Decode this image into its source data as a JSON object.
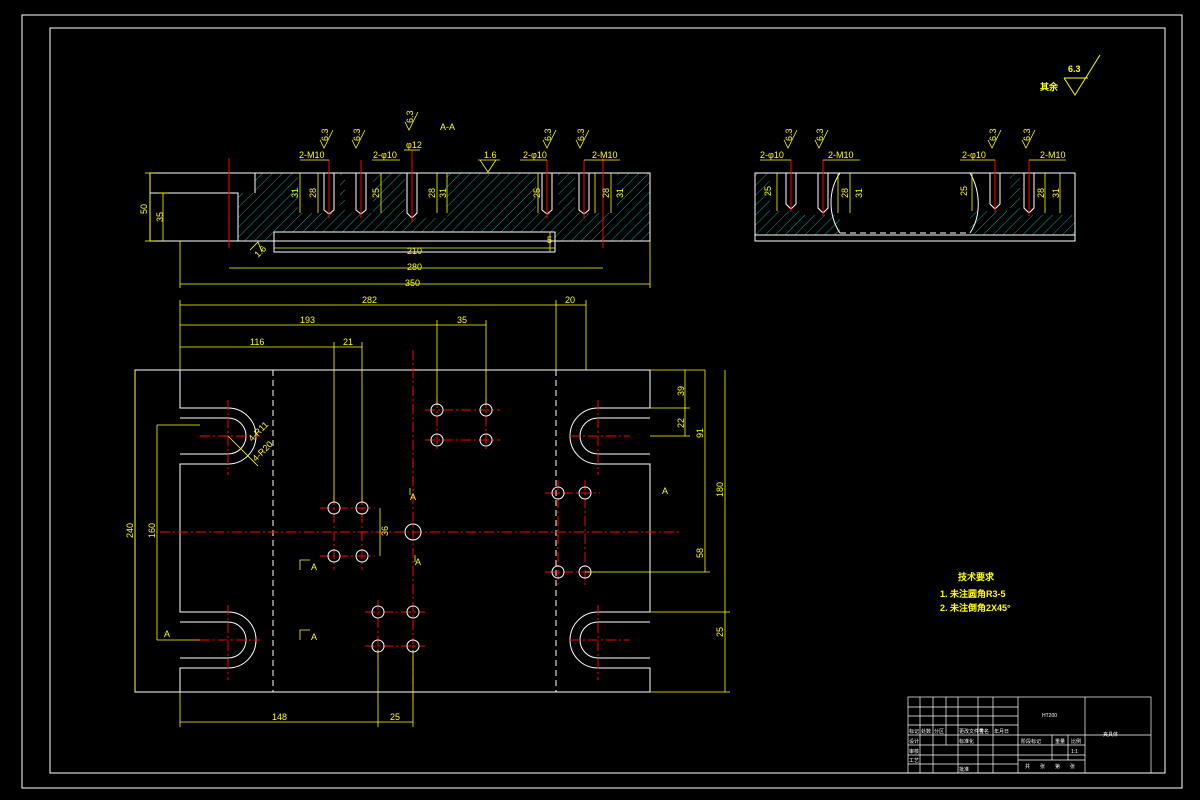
{
  "surface_finish": {
    "label": "其余",
    "value": "6.3"
  },
  "section_views": {
    "left": {
      "section_label": "A-A",
      "callouts": {
        "m10_left": "2-M10",
        "phi10_left": "2-φ10",
        "phi12": "φ12",
        "phi10_right": "2-φ10",
        "m10_right": "2-M10"
      },
      "roughness": [
        "6.3",
        "6.3",
        "6.3",
        "6.3",
        "6.3",
        "1.6"
      ],
      "dims": {
        "h50": "50",
        "h35": "35",
        "d31a": "31",
        "d28a": "28",
        "d25a": "25",
        "d28b": "28",
        "d31b": "31",
        "d25c": "25",
        "d28c": "28",
        "d31c": "31",
        "slot_depth": "5",
        "w210": "210",
        "w280": "280",
        "w350": "350",
        "rough_bottom": "1.6"
      }
    },
    "right": {
      "callouts": {
        "phi10_left": "2-φ10",
        "m10_left": "2-M10",
        "phi10_right": "2-φ10",
        "m10_right": "2-M10"
      },
      "roughness": [
        "6.3",
        "6.3",
        "6.3",
        "6.3"
      ],
      "dims": {
        "d25a": "25",
        "d28a": "28",
        "d31a": "31",
        "d25b": "25",
        "d28b": "28",
        "d31b": "31"
      }
    }
  },
  "plan_view": {
    "dims": {
      "w282": "282",
      "w20": "20",
      "w193": "193",
      "w35": "35",
      "w116": "116",
      "w21": "21",
      "w148": "148",
      "w25b": "25",
      "h240": "240",
      "h160": "160",
      "h36": "36",
      "v39": "39",
      "v22": "22",
      "v91": "91",
      "v180": "180",
      "v58": "58",
      "v25": "25"
    },
    "radius_labels": {
      "r11": "4-R11",
      "r20": "4-R20"
    },
    "section_marks": [
      "A",
      "A",
      "A",
      "A",
      "A",
      "A"
    ]
  },
  "tech_requirements": {
    "title": "技术要求",
    "items": [
      "1. 未注圆角R3-5",
      "2. 未注倒角2X45°"
    ]
  },
  "title_block": {
    "material": "HT200",
    "part_name": "夹具体",
    "cells": [
      "标记",
      "处数",
      "分区",
      "更改文件号",
      "签名",
      "年月日",
      "设计",
      "标准化",
      "审核",
      "工艺",
      "批准",
      "阶段标记",
      "重量",
      "比例",
      "1:1",
      "共",
      "张",
      "第",
      "张"
    ]
  },
  "colors": {
    "background": "#000000",
    "outline": "#ffffff",
    "dimension": "#ffff00",
    "centerline": "#ff0000",
    "hatch": "#00cccc"
  }
}
